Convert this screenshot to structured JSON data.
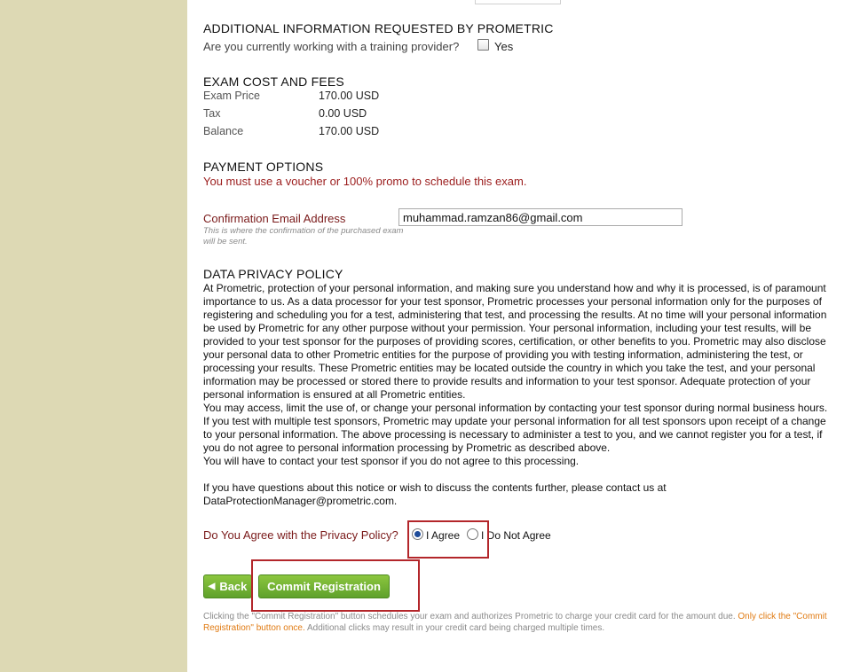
{
  "additional_info": {
    "heading": "ADDITIONAL INFORMATION REQUESTED BY PROMETRIC",
    "question": "Are you currently working with a training provider?",
    "yes_label": "Yes"
  },
  "exam_cost": {
    "heading": "EXAM COST AND FEES",
    "rows": [
      {
        "label": "Exam Price",
        "value": "170.00 USD"
      },
      {
        "label": "Tax",
        "value": "0.00 USD"
      },
      {
        "label": "Balance",
        "value": "170.00 USD"
      }
    ]
  },
  "payment": {
    "heading": "PAYMENT OPTIONS",
    "warning": "You must use a voucher or 100% promo to schedule this exam."
  },
  "email": {
    "label": "Confirmation Email Address",
    "hint": "This is where the confirmation of the purchased exam will be sent.",
    "value": "muhammad.ramzan86@gmail.com"
  },
  "privacy": {
    "heading": "DATA PRIVACY POLICY",
    "paragraph1": "At Prometric, protection of your personal information, and making sure you understand how and why it is processed, is of paramount importance to us. As a data processor for your test sponsor, Prometric processes your personal information only for the purposes of registering and scheduling you for a test, administering that test, and processing the results. At no time will your personal information be used by Prometric for any other purpose without your permission. Your personal information, including your test results, will be provided to your test sponsor for the purposes of providing scores, certification, or other benefits to you. Prometric may also disclose your personal data to other Prometric entities for the purpose of providing you with testing information, administering the test, or processing your results. These Prometric entities may be located outside the country in which you take the test, and your personal information may be processed or stored there to provide results and information to your test sponsor. Adequate protection of your personal information is ensured at all Prometric entities.",
    "paragraph2": "You may access, limit the use of, or change your personal information by contacting your test sponsor during normal business hours. If you test with multiple test sponsors, Prometric may update your personal information for all test sponsors upon receipt of a change to your personal information. The above processing is necessary to administer a test to you, and we cannot register you for a test, if you do not agree to personal information processing by Prometric as described above.",
    "paragraph3": "You will have to contact your test sponsor if you do not agree to this processing.",
    "paragraph4": "If you have questions about this notice or wish to discuss the contents further, please contact us at DataProtectionManager@prometric.com.",
    "agree_question": "Do You Agree with the Privacy Policy?",
    "agree_label": "I Agree",
    "disagree_label": "I Do Not Agree",
    "selected": "I Agree"
  },
  "actions": {
    "back_label": "Back",
    "commit_label": "Commit Registration"
  },
  "footnote": {
    "text": "Clicking the \"Commit Registration\" button schedules your exam and authorizes Prometric to charge your credit card for the amount due.",
    "warning": "Only click the \"Commit Registration\" button once.",
    "tail": "Additional clicks may result in your credit card being charged multiple times."
  },
  "colors": {
    "left_rail": "#ddd9b4",
    "label_red": "#7a1a1a",
    "warning_red": "#9b1c1c",
    "button_green": "#6fb32f",
    "highlight_box": "#b3262a",
    "footnote_orange": "#e07a12"
  }
}
